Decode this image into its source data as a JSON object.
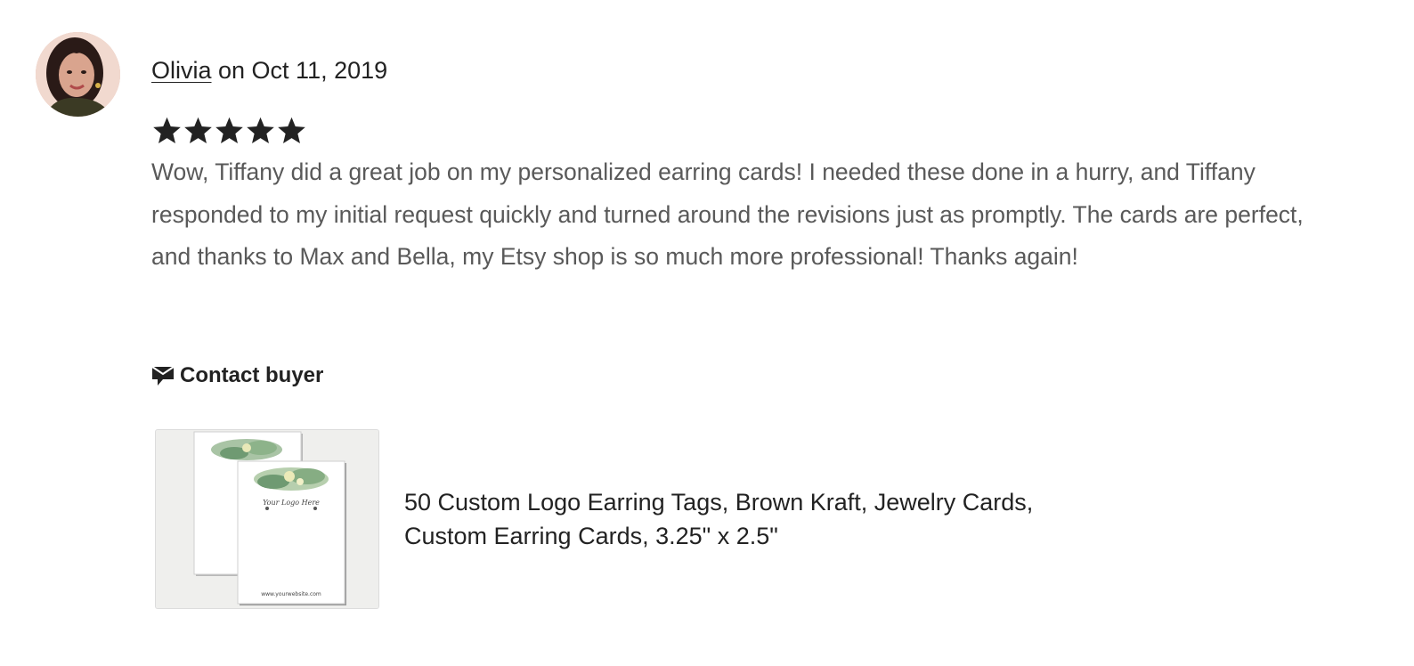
{
  "review": {
    "reviewer_name": "Olivia",
    "date_text": " on Oct 11, 2019",
    "rating": 5,
    "rating_max": 5,
    "text": "Wow, Tiffany did a great job on my personalized earring cards! I needed these done in a hurry, and Tiffany responded to my initial request quickly and turned around the revisions just as promptly. The cards are perfect, and thanks to Max and Bella, my Etsy shop is so much more professional! Thanks again!",
    "contact_label": "Contact buyer"
  },
  "listing": {
    "title": "50 Custom Logo Earring Tags, Brown Kraft, Jewelry Cards, Custom Earring Cards, 3.25\" x 2.5\"",
    "card_logo_text": "Your Logo Here",
    "card_website_text": "www.yourwebsite.com"
  },
  "icons": {
    "star": "star-icon",
    "contact": "envelope-chat-icon"
  },
  "colors": {
    "text_primary": "#222222",
    "text_secondary": "#595959",
    "thumb_bg": "#efefed",
    "star": "#222222"
  }
}
